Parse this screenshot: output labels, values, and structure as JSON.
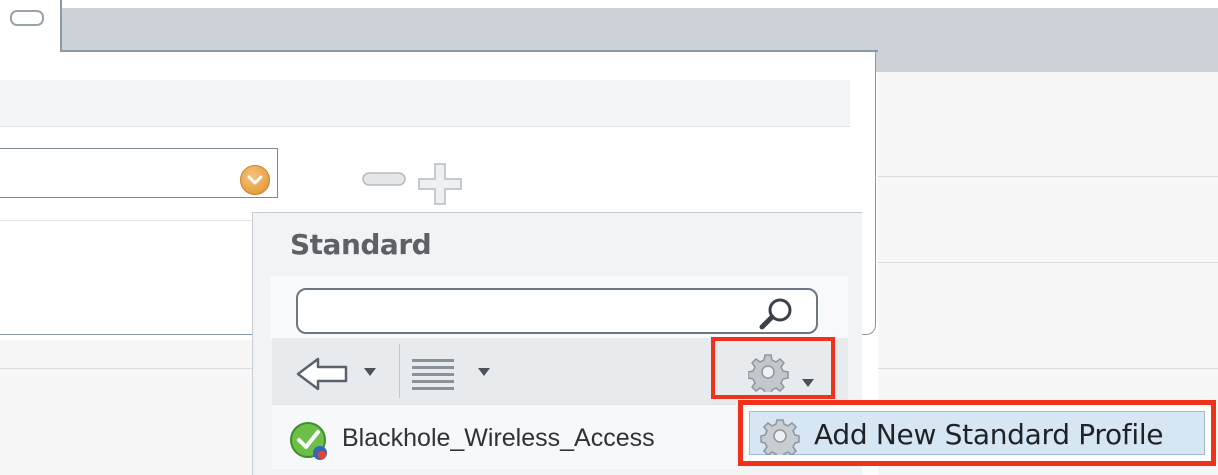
{
  "popup": {
    "title": "Standard",
    "search": {
      "value": "",
      "placeholder": ""
    },
    "toolbar": {
      "back_icon": "arrow-left-icon",
      "list_icon": "list-lines-icon",
      "settings_icon": "gear-icon"
    },
    "rows": [
      {
        "label": "Blackhole_Wireless_Access",
        "status_icon": "check-shield-icon"
      }
    ]
  },
  "context_menu": {
    "items": [
      {
        "label": "Add New Standard Profile",
        "icon": "gear-icon"
      }
    ]
  },
  "form": {
    "selected_value": "",
    "minus_icon": "minus-icon",
    "plus_icon": "plus-icon"
  },
  "colors": {
    "highlight": "#f0311b",
    "menu_hover": "#d6e6f3",
    "select_arrow": "#e0922e"
  }
}
